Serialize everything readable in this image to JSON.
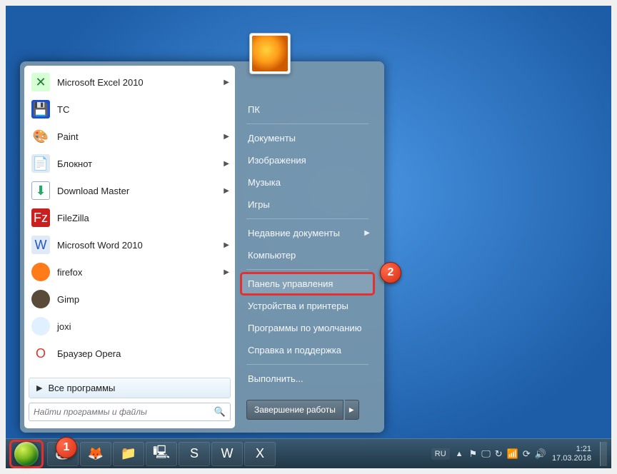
{
  "start_menu": {
    "programs": [
      {
        "label": "Microsoft Excel 2010",
        "icon": "✕",
        "icon_class": "ic-excel",
        "submenu": true
      },
      {
        "label": "TC",
        "icon": "💾",
        "icon_class": "ic-tc",
        "submenu": false
      },
      {
        "label": "Paint",
        "icon": "🎨",
        "icon_class": "ic-paint",
        "submenu": true
      },
      {
        "label": "Блокнот",
        "icon": "📄",
        "icon_class": "ic-notepad",
        "submenu": true
      },
      {
        "label": "Download Master",
        "icon": "⬇",
        "icon_class": "ic-dm",
        "submenu": true
      },
      {
        "label": "FileZilla",
        "icon": "Fz",
        "icon_class": "ic-fz",
        "submenu": false
      },
      {
        "label": "Microsoft Word 2010",
        "icon": "W",
        "icon_class": "ic-word",
        "submenu": true
      },
      {
        "label": "firefox",
        "icon": "",
        "icon_class": "ic-ff",
        "submenu": true
      },
      {
        "label": "Gimp",
        "icon": "",
        "icon_class": "ic-gimp",
        "submenu": false
      },
      {
        "label": "joxi",
        "icon": "",
        "icon_class": "ic-joxi",
        "submenu": false
      },
      {
        "label": "Браузер Opera",
        "icon": "O",
        "icon_class": "ic-opera",
        "submenu": false
      }
    ],
    "all_programs": "Все программы",
    "search_placeholder": "Найти программы и файлы",
    "right_items": [
      "ПК",
      "Документы",
      "Изображения",
      "Музыка",
      "Игры",
      "Недавние документы",
      "Компьютер",
      "Панель управления",
      "Устройства и принтеры",
      "Программы по умолчанию",
      "Справка и поддержка",
      "Выполнить..."
    ],
    "right_submenu_indices": [
      5
    ],
    "highlighted_right_index": 7,
    "shutdown_label": "Завершение работы"
  },
  "taskbar": {
    "pinned": [
      "panda-icon",
      "firefox-icon",
      "files-icon",
      "terminal-icon",
      "skype-icon",
      "word-icon",
      "excel-icon"
    ],
    "lang": "RU",
    "tray_icons": [
      "flag-icon",
      "monitor-icon",
      "sync-icon",
      "network-icon",
      "update-icon",
      "volume-icon"
    ],
    "time": "1:21",
    "date": "17.03.2018"
  },
  "annotations": {
    "marker1": "1",
    "marker2": "2"
  }
}
